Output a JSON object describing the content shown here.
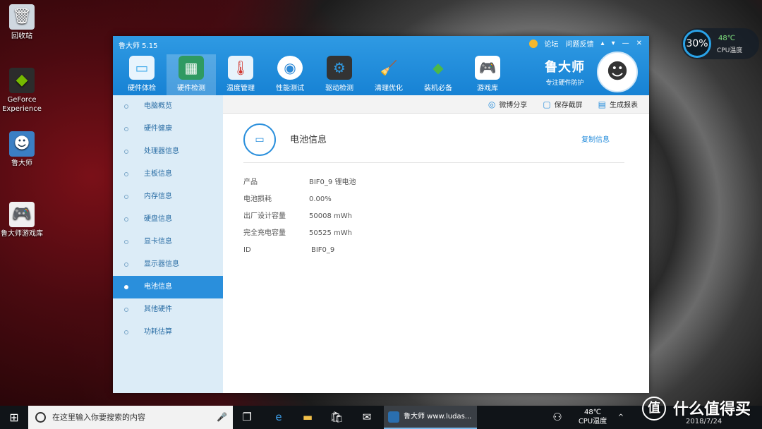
{
  "desktop": {
    "icons": [
      {
        "label": "回收站",
        "glyph": "🗑"
      },
      {
        "label": "GeForce Experience",
        "glyph": "◆"
      },
      {
        "label": "鲁大师",
        "glyph": "☻"
      },
      {
        "label": "鲁大师游戏库",
        "glyph": "🎮"
      }
    ],
    "cpu_widget": {
      "usage": "30%",
      "temp": "48℃",
      "label": "CPU温度"
    }
  },
  "window": {
    "title": "鲁大师 5.15",
    "top_links": [
      "论坛",
      "问题反馈"
    ],
    "toolbar": [
      {
        "label": "硬件体检",
        "glyph": "💻",
        "color": "#3aa7ea"
      },
      {
        "label": "硬件检测",
        "glyph": "▦",
        "color": "#2f9a62"
      },
      {
        "label": "温度管理",
        "glyph": "🌡",
        "color": "#e8f3fb"
      },
      {
        "label": "性能测试",
        "glyph": "◉",
        "color": "#2d89d6"
      },
      {
        "label": "驱动检测",
        "glyph": "⚙",
        "color": "#333"
      },
      {
        "label": "清理优化",
        "glyph": "🧹",
        "color": "#f5a623"
      },
      {
        "label": "装机必备",
        "glyph": "◆",
        "color": "#4cb848"
      },
      {
        "label": "游戏库",
        "glyph": "🎮",
        "color": "#ffffff"
      }
    ],
    "active_tool": 1,
    "brand": {
      "name": "鲁大师",
      "slogan": "专注硬件防护",
      "avatar": "☻"
    },
    "actions": [
      {
        "label": "微博分享",
        "glyph": "◎"
      },
      {
        "label": "保存截屏",
        "glyph": "▢"
      },
      {
        "label": "生成报表",
        "glyph": "▤"
      }
    ],
    "sidebar": [
      {
        "label": "电脑概览"
      },
      {
        "label": "硬件健康"
      },
      {
        "label": "处理器信息"
      },
      {
        "label": "主板信息"
      },
      {
        "label": "内存信息"
      },
      {
        "label": "硬盘信息"
      },
      {
        "label": "显卡信息"
      },
      {
        "label": "显示器信息"
      },
      {
        "label": "电池信息",
        "active": true
      },
      {
        "label": "其他硬件"
      },
      {
        "label": "功耗估算"
      }
    ],
    "section": {
      "title": "电池信息",
      "copy_label": "复制信息",
      "rows": [
        {
          "key": "产品",
          "value": "BIF0_9 锂电池"
        },
        {
          "key": "电池损耗",
          "value": "0.00%"
        },
        {
          "key": "出厂设计容量",
          "value": "50008 mWh"
        },
        {
          "key": "完全充电容量",
          "value": "50525 mWh"
        },
        {
          "key": "ID",
          "value": "BIF0_9"
        }
      ]
    }
  },
  "taskbar": {
    "search_placeholder": "在这里输入你要搜索的内容",
    "app_label": "鲁大师 www.ludas...",
    "tray_temp": "48℃",
    "tray_label": "CPU温度",
    "date": "2018/7/24"
  },
  "watermark": "什么值得买",
  "colors": {
    "accent": "#2a8fdc",
    "titlebar": "#1f8bd9",
    "sidebar": "#dcecf7"
  }
}
